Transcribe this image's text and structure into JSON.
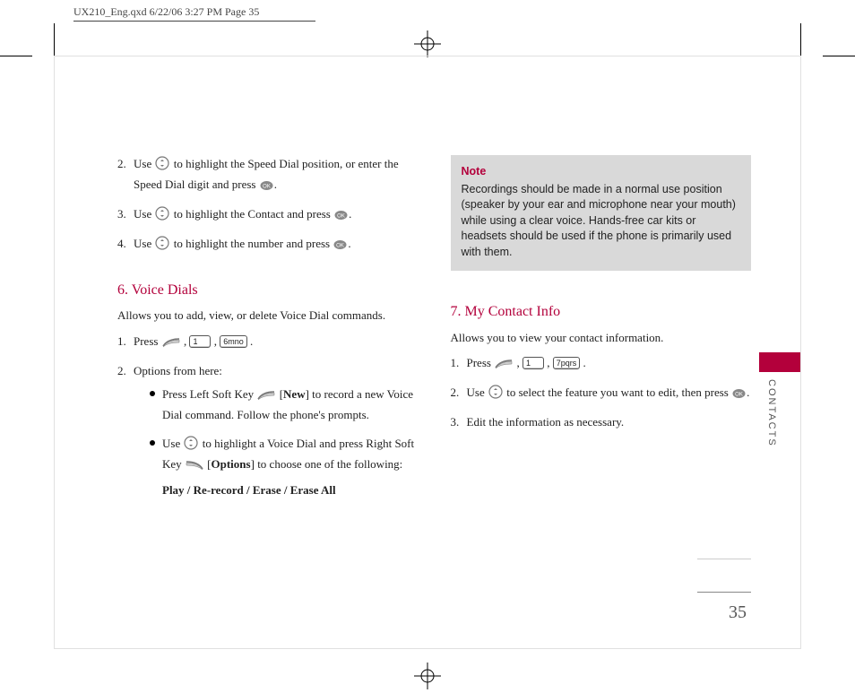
{
  "print_header": "UX210_Eng.qxd  6/22/06  3:27 PM  Page 35",
  "side_label": "CONTACTS",
  "page_number": "35",
  "left": {
    "steps_cont": [
      {
        "num": "2.",
        "pre": "Use ",
        "icon": "nav",
        "mid": " to highlight the Speed Dial position, or enter the Speed Dial digit and press ",
        "end_icon": "ok",
        "suffix": "."
      },
      {
        "num": "3.",
        "pre": "Use ",
        "icon": "nav",
        "mid": " to highlight the Contact and press ",
        "end_icon": "ok",
        "suffix": "."
      },
      {
        "num": "4.",
        "pre": "Use ",
        "icon": "nav",
        "mid": " to highlight the number and press ",
        "end_icon": "ok",
        "suffix": "."
      }
    ],
    "section6": {
      "heading": "6. Voice Dials",
      "intro": "Allows you to add, view, or delete Voice Dial commands.",
      "step1": {
        "num": "1.",
        "text": "Press ",
        "keys": [
          "soft",
          "1",
          "6mno"
        ],
        "after": " ."
      },
      "step2": {
        "num": "2.",
        "text": "Options from here:"
      },
      "bullets": [
        {
          "pre": "Press Left Soft Key ",
          "soft_icon": "soft",
          "bracket": "New",
          "post": " to record a new Voice Dial command. Follow the phone's prompts."
        },
        {
          "pre": "Use ",
          "nav_icon": "nav",
          "mid": " to highlight a Voice Dial and press Right Soft Key ",
          "soft_icon2": "softr",
          "bracket": "Options",
          "post": " to choose one of the following:",
          "options_label": "Play / Re-record / Erase / Erase All"
        }
      ]
    }
  },
  "right": {
    "note": {
      "title": "Note",
      "body": "Recordings should be made in a normal use position (speaker by your ear and microphone near your mouth) while using a clear voice. Hands-free car kits or headsets should be used if the phone is primarily used with them."
    },
    "section7": {
      "heading": "7. My Contact Info",
      "intro": "Allows you to view your contact information.",
      "step1": {
        "num": "1.",
        "text": "Press ",
        "keys": [
          "soft",
          "1",
          "7pqrs"
        ],
        "after": " ."
      },
      "step2": {
        "num": "2.",
        "pre": "Use ",
        "icon": "nav",
        "mid": " to select the feature you want to edit, then press ",
        "end_icon": "ok",
        "suffix": "."
      },
      "step3": {
        "num": "3.",
        "text": "Edit the information as necessary."
      }
    }
  }
}
